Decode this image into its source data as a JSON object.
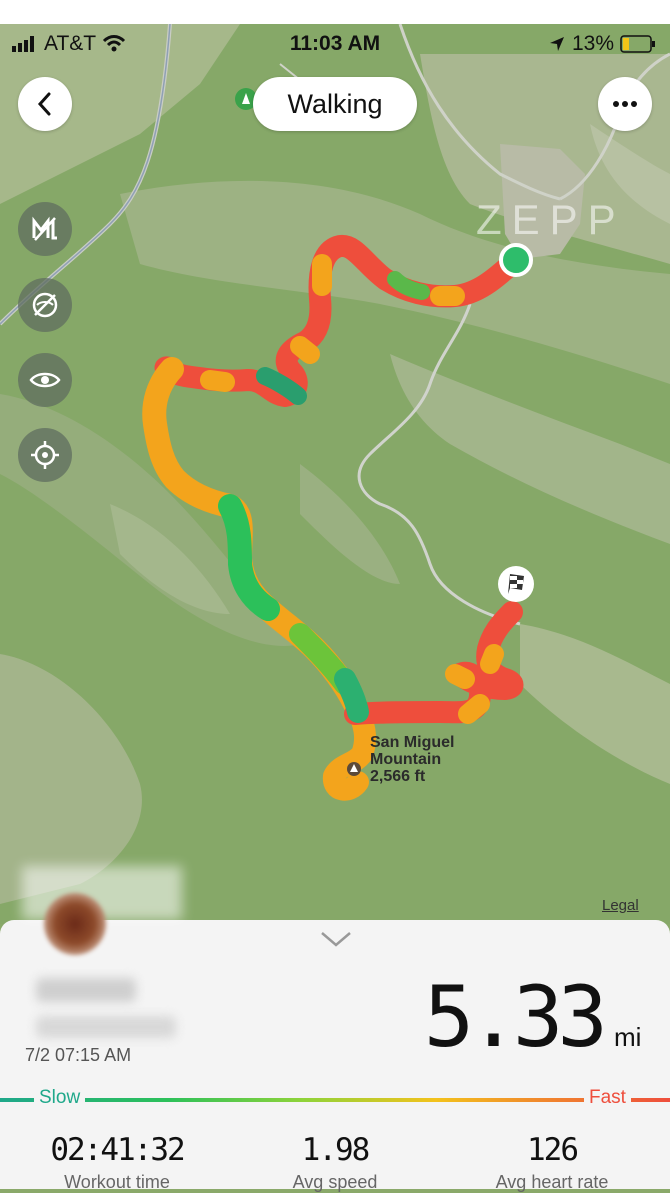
{
  "status_bar": {
    "carrier": "AT&T",
    "time": "11:03 AM",
    "battery": "13%"
  },
  "header": {
    "title": "Walking"
  },
  "map": {
    "watermark": "ZEPP",
    "peak_name_line1": "San Miguel",
    "peak_name_line2": "Mountain",
    "peak_elevation": "2,566 ft",
    "legal": "Legal"
  },
  "workout": {
    "date": "7/2 07:15 AM",
    "distance": "5.33",
    "distance_unit": "mi",
    "speed_scale": {
      "slow": "Slow",
      "fast": "Fast"
    },
    "stats": [
      {
        "value": "02:41:32",
        "label": "Workout time"
      },
      {
        "value": "1.98",
        "label": "Avg speed"
      },
      {
        "value": "126",
        "label": "Avg heart rate"
      }
    ]
  },
  "colors": {
    "route_fast": "#ee4e3c",
    "route_medium": "#f3a41c",
    "route_slow": "#2cc05a",
    "start_marker": "#2ebd6b"
  },
  "icons": [
    "signal-icon",
    "wifi-icon",
    "location-arrow-icon",
    "battery-icon",
    "back-icon",
    "more-icon",
    "map-style-icon",
    "satellite-off-icon",
    "eye-icon",
    "locate-icon",
    "finish-flag-icon",
    "peak-icon",
    "chevron-down-icon",
    "park-icon"
  ]
}
